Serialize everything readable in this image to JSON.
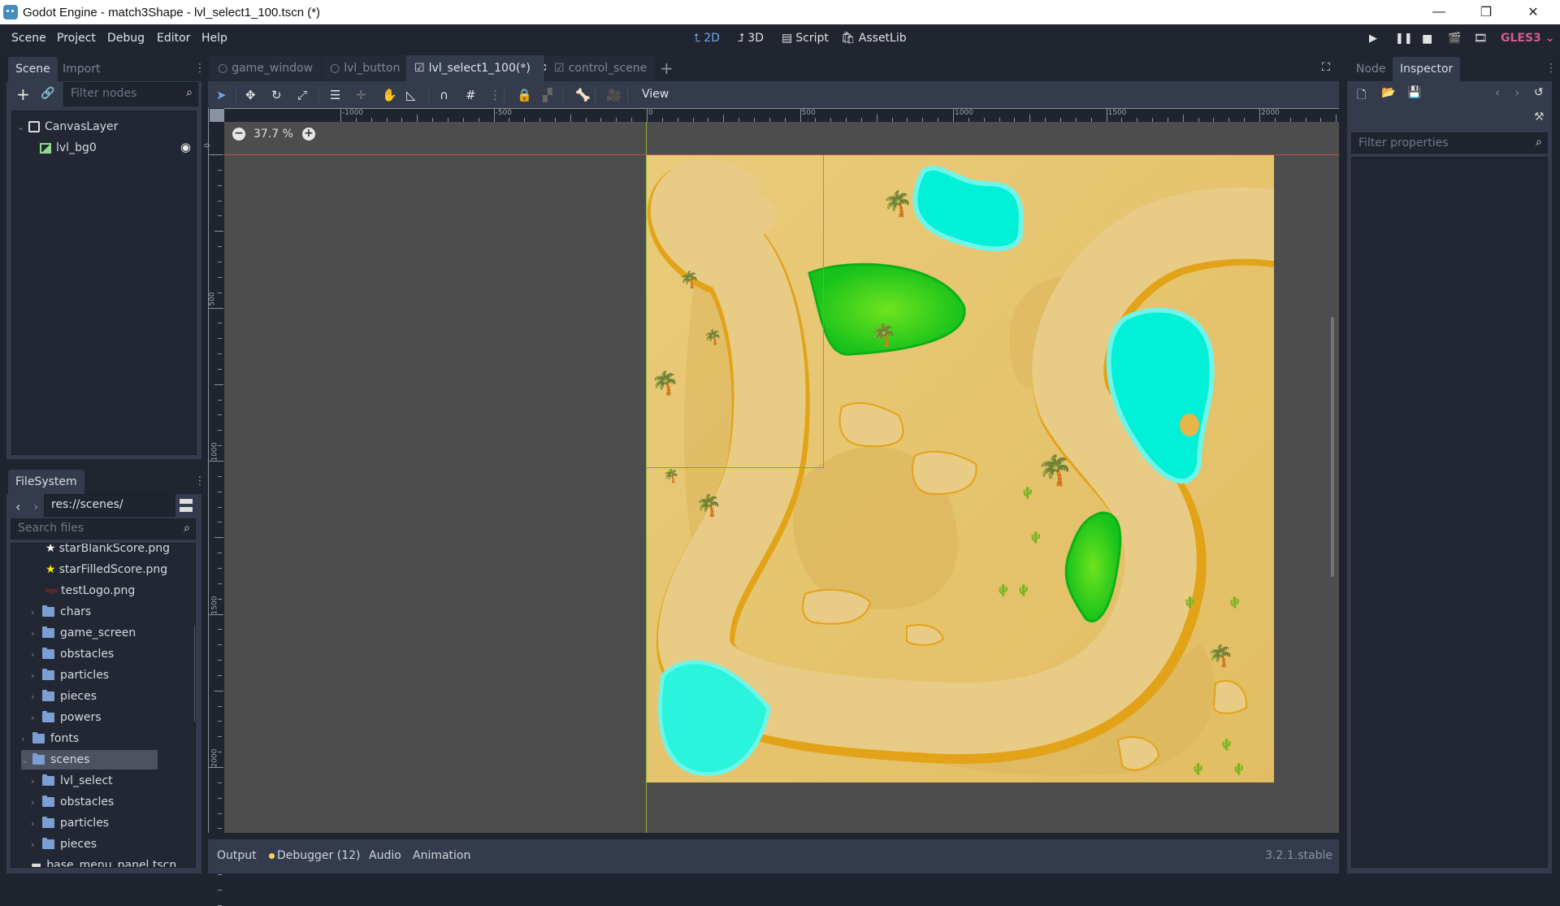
{
  "window": {
    "title": "Godot Engine - match3Shape - lvl_select1_100.tscn (*)",
    "controls": [
      "minimize",
      "maximize",
      "close"
    ]
  },
  "menu": {
    "items": [
      "Scene",
      "Project",
      "Debug",
      "Editor",
      "Help"
    ],
    "workspaces": [
      {
        "label": "2D",
        "icon": "2d-icon",
        "active": true
      },
      {
        "label": "3D",
        "icon": "3d-icon",
        "active": false
      },
      {
        "label": "Script",
        "icon": "script-icon",
        "active": false
      },
      {
        "label": "AssetLib",
        "icon": "assetlib-icon",
        "active": false
      }
    ],
    "run_buttons": [
      "play",
      "pause",
      "stop",
      "play-scene",
      "play-custom-scene"
    ],
    "renderer": "GLES3"
  },
  "scene_dock": {
    "tabs": [
      "Scene",
      "Import"
    ],
    "active_tab": "Scene",
    "filter_placeholder": "Filter nodes",
    "nodes": [
      {
        "name": "CanvasLayer",
        "icon": "canvaslayer-icon",
        "expanded": true
      },
      {
        "name": "lvl_bg0",
        "icon": "texturerect-icon",
        "visible": true
      }
    ]
  },
  "filesystem": {
    "title": "FileSystem",
    "path": "res://scenes/",
    "search_placeholder": "Search files",
    "items": [
      {
        "name": "starBlankScore.png",
        "type": "image-star-blank",
        "level": 3
      },
      {
        "name": "starFilledScore.png",
        "type": "image-star-filled",
        "level": 3
      },
      {
        "name": "testLogo.png",
        "type": "image-logo",
        "level": 3
      },
      {
        "name": "chars",
        "type": "folder",
        "level": 2
      },
      {
        "name": "game_screen",
        "type": "folder",
        "level": 2
      },
      {
        "name": "obstacles",
        "type": "folder",
        "level": 2
      },
      {
        "name": "particles",
        "type": "folder",
        "level": 2
      },
      {
        "name": "pieces",
        "type": "folder",
        "level": 2
      },
      {
        "name": "powers",
        "type": "folder",
        "level": 2
      },
      {
        "name": "fonts",
        "type": "folder",
        "level": 1
      },
      {
        "name": "scenes",
        "type": "folder-open",
        "level": 1,
        "selected": true
      },
      {
        "name": "lvl_select",
        "type": "folder",
        "level": 2
      },
      {
        "name": "obstacles",
        "type": "folder",
        "level": 2
      },
      {
        "name": "particles",
        "type": "folder",
        "level": 2
      },
      {
        "name": "pieces",
        "type": "folder",
        "level": 2
      },
      {
        "name": "base_menu_panel.tscn",
        "type": "scene",
        "level": 2
      }
    ]
  },
  "editor_tabs": [
    {
      "label": "game_window",
      "icon": "node-icon",
      "active": false
    },
    {
      "label": "lvl_button",
      "icon": "node-icon",
      "active": false
    },
    {
      "label": "lvl_select1_100(*)",
      "icon": "canvaslayer-icon",
      "active": true,
      "closable": true
    },
    {
      "label": "control_scene",
      "icon": "canvaslayer-icon",
      "active": false
    }
  ],
  "toolbar": {
    "tools": [
      "select",
      "move",
      "rotate",
      "scale",
      "list-select",
      "pivot",
      "pan",
      "ruler",
      "smart-snap",
      "grid-snap",
      "more",
      "lock",
      "group",
      "bones",
      "camera"
    ],
    "view_label": "View"
  },
  "viewport": {
    "zoom": "37.7 %",
    "h_ruler_labels": [
      "-1000",
      "-500",
      "0",
      "500",
      "1000",
      "1500",
      "2000"
    ],
    "v_ruler_labels": [
      "0",
      "500",
      "1000",
      "1500",
      "2000"
    ],
    "scene_content": "desert level-select map with winding sand path, oases, palm trees and cacti"
  },
  "bottom_panel": {
    "tabs": [
      "Output",
      "Debugger (12)",
      "Audio",
      "Animation"
    ],
    "debugger_indicator_color": "#f5d35a",
    "version": "3.2.1.stable"
  },
  "inspector_dock": {
    "tabs": [
      "Node",
      "Inspector"
    ],
    "active_tab": "Inspector",
    "filter_placeholder": "Filter properties"
  },
  "colors": {
    "accent": "#6ba7f0",
    "renderer": "#d15c91",
    "sand": "#e8c76d",
    "water": "#00f0d8",
    "grass": "#3ccf1c"
  }
}
